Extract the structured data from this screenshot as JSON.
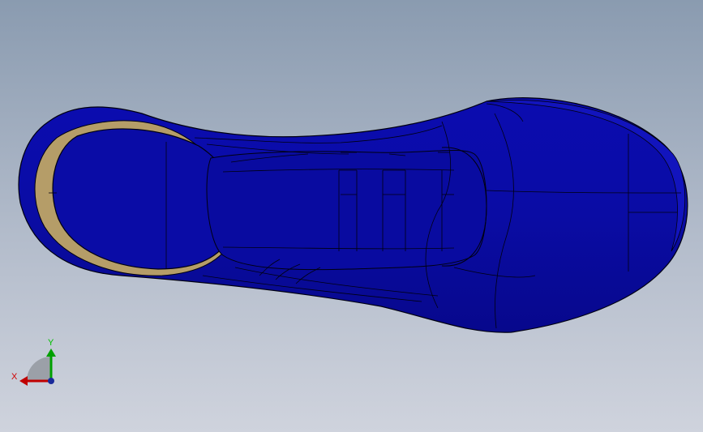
{
  "triad": {
    "x_label": "X",
    "y_label": "Y",
    "colors": {
      "x_axis": "#c00000",
      "y_axis": "#00a000",
      "z_axis": "#1a2a9a",
      "quadrant": "#9ba0a8"
    }
  },
  "model": {
    "colors": {
      "body": "#0a0ca6",
      "body_dark": "#050682",
      "edge": "#000010",
      "inner_ring": "#b8a06a"
    }
  }
}
